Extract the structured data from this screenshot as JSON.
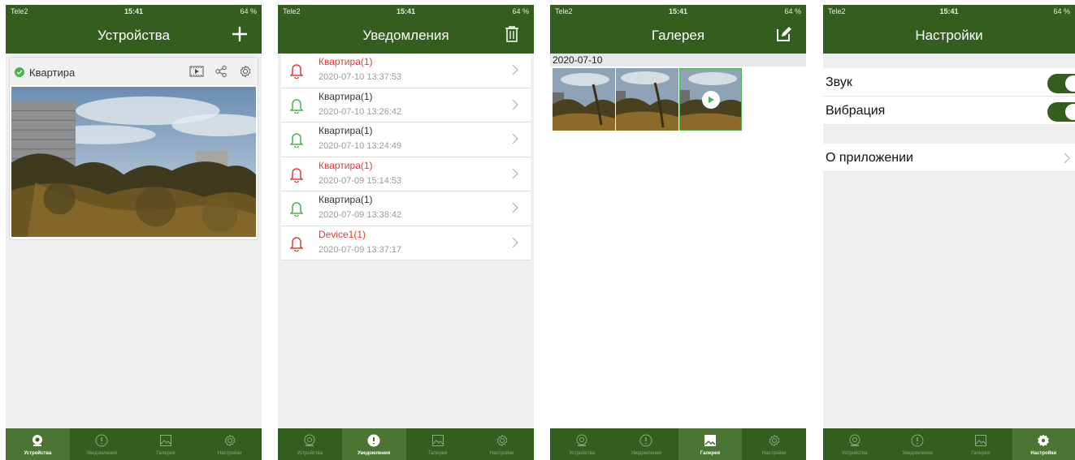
{
  "status_bar": {
    "carrier": "Tele2",
    "time": "15:41",
    "battery": "64 %"
  },
  "tabs": [
    "Устройства",
    "Уведомления",
    "Галерея",
    "Настройки"
  ],
  "colors": {
    "brand_green": "#335e1e",
    "alert_red": "#e53935",
    "normal_green": "#4caf50"
  },
  "devices": {
    "title": "Устройства",
    "device_name": "Квартира",
    "icons": [
      "add-icon",
      "playback-icon",
      "share-icon",
      "settings-icon"
    ]
  },
  "notifications": {
    "title": "Уведомления",
    "items": [
      {
        "name": "Квартира(1)",
        "time": "2020-07-10 13:37:53",
        "level": "alert"
      },
      {
        "name": "Квартира(1)",
        "time": "2020-07-10 13:26:42",
        "level": "normal"
      },
      {
        "name": "Квартира(1)",
        "time": "2020-07-10 13:24:49",
        "level": "normal"
      },
      {
        "name": "Квартира(1)",
        "time": "2020-07-09 15:14:53",
        "level": "alert"
      },
      {
        "name": "Квартира(1)",
        "time": "2020-07-09 13:38:42",
        "level": "normal"
      },
      {
        "name": "Device1(1)",
        "time": "2020-07-09 13:37:17",
        "level": "alert"
      }
    ]
  },
  "gallery": {
    "title": "Галерея",
    "date": "2020-07-10"
  },
  "settings": {
    "title": "Настройки",
    "sound_label": "Звук",
    "sound_on": true,
    "vibration_label": "Вибрация",
    "vibration_on": true,
    "about_label": "О приложении"
  }
}
